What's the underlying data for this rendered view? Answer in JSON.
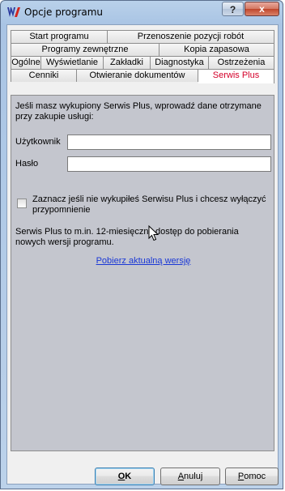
{
  "window": {
    "title": "Opcje programu",
    "help_glyph": "?",
    "close_glyph": "x",
    "app_icon": "app-logo-icon"
  },
  "tabs": {
    "row1": [
      "Start programu",
      "Przenoszenie pozycji robót"
    ],
    "row2": [
      "Programy zewnętrzne",
      "Kopia zapasowa"
    ],
    "row3": [
      "Ogólne",
      "Wyświetlanie",
      "Zakładki",
      "Diagnostyka",
      "Ostrzeżenia"
    ],
    "row4": [
      "Cenniki",
      "Otwieranie dokumentów",
      "Serwis Plus"
    ],
    "active": "Serwis Plus"
  },
  "panel": {
    "intro": "Jeśli masz wykupiony Serwis Plus, wprowadź dane otrzymane przy zakupie usługi:",
    "user_label": "Użytkownik",
    "user_value": "",
    "password_label": "Hasło",
    "password_value": "",
    "checkbox_label": "Zaznacz jeśli nie wykupiłeś Serwisu Plus i chcesz wyłączyć przypomnienie",
    "checkbox_checked": false,
    "info": "Serwis Plus to m.in. 12-miesięczny dostęp do pobierania nowych wersji programu.",
    "link": "Pobierz aktualną wersję"
  },
  "buttons": {
    "ok_u": "O",
    "ok_rest": "K",
    "cancel_u": "A",
    "cancel_rest": "nuluj",
    "help_u": "P",
    "help_rest": "omoc"
  },
  "colors": {
    "active_tab_text": "#d4002a",
    "panel_bg": "#c4c6ce",
    "link": "#1a38d6"
  }
}
